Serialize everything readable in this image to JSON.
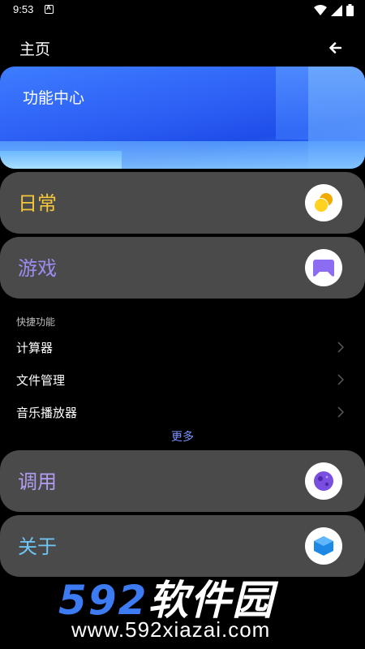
{
  "status_bar": {
    "time": "9:53"
  },
  "header": {
    "title": "主页"
  },
  "banner": {
    "title": "功能中心"
  },
  "cards": [
    {
      "label": "日常",
      "label_color": "#F4C63A",
      "icon": "coins-icon"
    },
    {
      "label": "游戏",
      "label_color": "#9C8CF0",
      "icon": "gamepad-icon"
    }
  ],
  "quick": {
    "section_title": "快捷功能",
    "items": [
      {
        "label": "计算器"
      },
      {
        "label": "文件管理"
      },
      {
        "label": "音乐播放器"
      }
    ],
    "more_label": "更多"
  },
  "cards2": [
    {
      "label": "调用",
      "label_color": "#B39DF2",
      "icon": "planet-icon"
    },
    {
      "label": "关于",
      "label_color": "#6FC7F5",
      "icon": "cube-icon"
    }
  ],
  "watermark": {
    "logo_digits": "592",
    "logo_text": "软件园",
    "url": "www.592xiazai.com"
  }
}
